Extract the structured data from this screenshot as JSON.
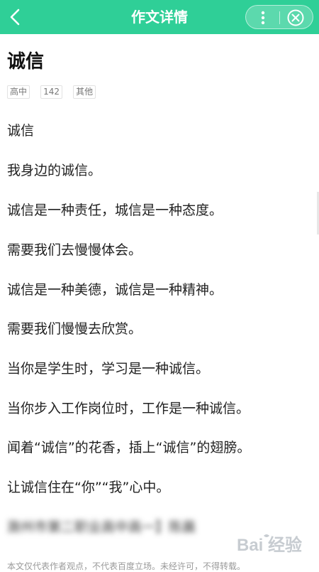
{
  "header": {
    "back_icon": "back-arrow-icon",
    "title": "作文详情",
    "more_icon": "more-vertical-icon",
    "close_icon": "close-circle-icon",
    "accent": "#2fcf97"
  },
  "article": {
    "title": "诚信",
    "tags": [
      "高中",
      "142",
      "其他"
    ],
    "paragraphs": [
      "诚信",
      "我身边的诚信。",
      "诚信是一种责任，城信是一种态度。",
      "需要我们去慢慢体会。",
      "诚信是一种美德，诚信是一种精神。",
      "需要我们慢慢去欣赏。",
      "当你是学生时，学习是一种诚信。",
      "当你步入工作岗位时，工作是一种诚信。",
      "闻着“诚信”的花香，插上“诚信”的翅膀。",
      "让诚信住在“你”“我”心中。"
    ],
    "author_blurred": "滁州市第二职业高中高一】陈晨",
    "footer_note": "本文仅代表作者观点，不代表百度立场。未经许可，不得转载。"
  },
  "watermark": {
    "text": "Bai 经验"
  }
}
